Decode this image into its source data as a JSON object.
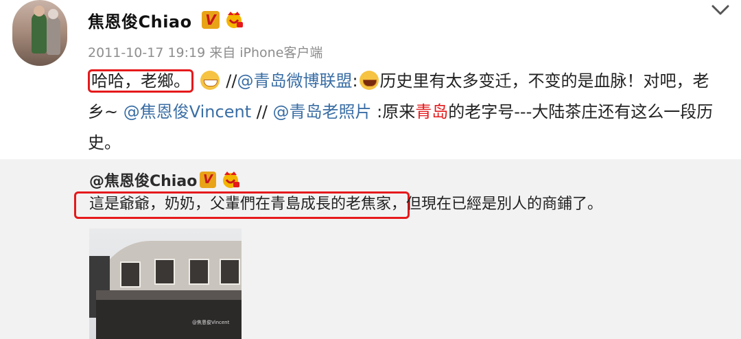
{
  "author": {
    "name": "焦恩俊Chiao"
  },
  "meta": {
    "time": "2011-10-17 19:19",
    "source": "来自 iPhone客户端"
  },
  "post": {
    "highlight": "哈哈，老鄉。",
    "sep1": " //",
    "mention1": "@青岛微博联盟",
    "colon1": ":",
    "text1": "历史里有太多变迁，不变的是血脉！对吧，老乡~ ",
    "mention2": "@焦恩俊Vincent",
    "sep2": " // ",
    "mention3": "@青岛老照片",
    "text2": " :原来",
    "red_word": "青岛",
    "text3": "的老字号---大陆茶庄还有这么一段历史。"
  },
  "repost": {
    "author": "@焦恩俊Chiao",
    "text_highlight": "這是爺爺，奶奶，父輩們在青島成長的老焦家，",
    "text_rest": "但現在已經是別人的商鋪了。",
    "photo_watermark": "@焦恩俊Vincent"
  },
  "icons": {
    "verified": "verified-v-icon",
    "vip": "vip-crown-icon",
    "more": "chevron-down-icon",
    "emoji_grin": "grin-emoji-icon",
    "emoji_laugh": "laugh-emoji-icon"
  },
  "colors": {
    "accent_red": "#e5191b",
    "link": "#3a6ea5",
    "badge": "#e8a317"
  }
}
